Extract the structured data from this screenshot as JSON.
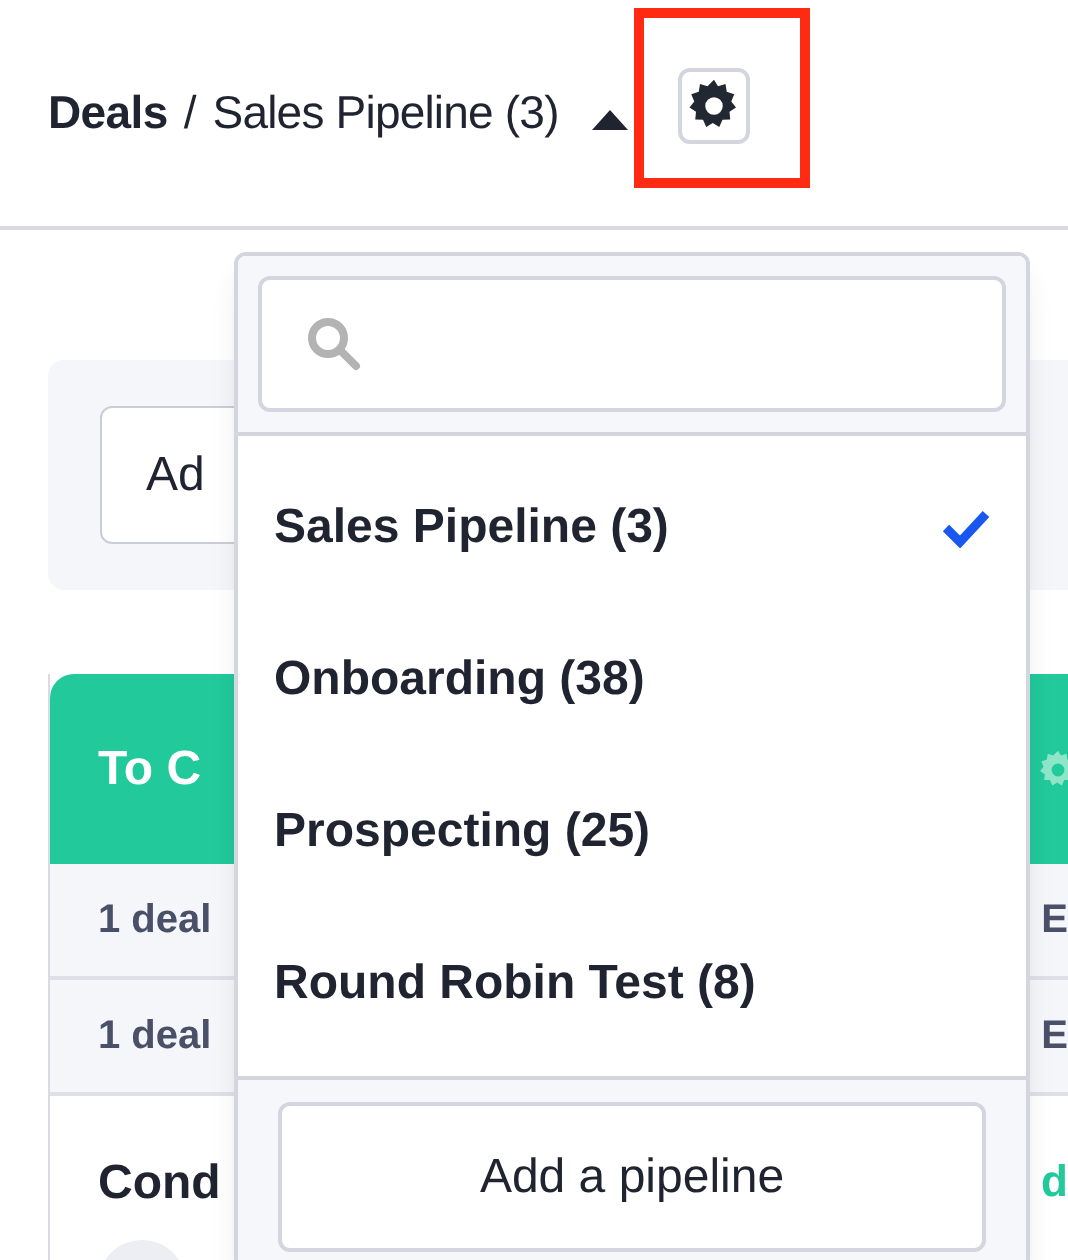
{
  "breadcrumb": {
    "root": "Deals",
    "separator": "/",
    "current": "Sales Pipeline (3)",
    "expanded": true
  },
  "settings_button": {
    "highlighted": true
  },
  "toolbar": {
    "button": "Ad"
  },
  "column": {
    "title": "To C",
    "rows": [
      {
        "left": "1 deal",
        "right": "E"
      },
      {
        "left": "1 deal",
        "right": "E"
      }
    ],
    "card": {
      "title": "Cond",
      "right": "d"
    }
  },
  "dropdown": {
    "items": [
      {
        "label": "Sales Pipeline (3)",
        "selected": true
      },
      {
        "label": "Onboarding (38)",
        "selected": false
      },
      {
        "label": "Prospecting (25)",
        "selected": false
      },
      {
        "label": "Round Robin Test (8)",
        "selected": false
      }
    ],
    "footer_button": "Add a pipeline"
  }
}
